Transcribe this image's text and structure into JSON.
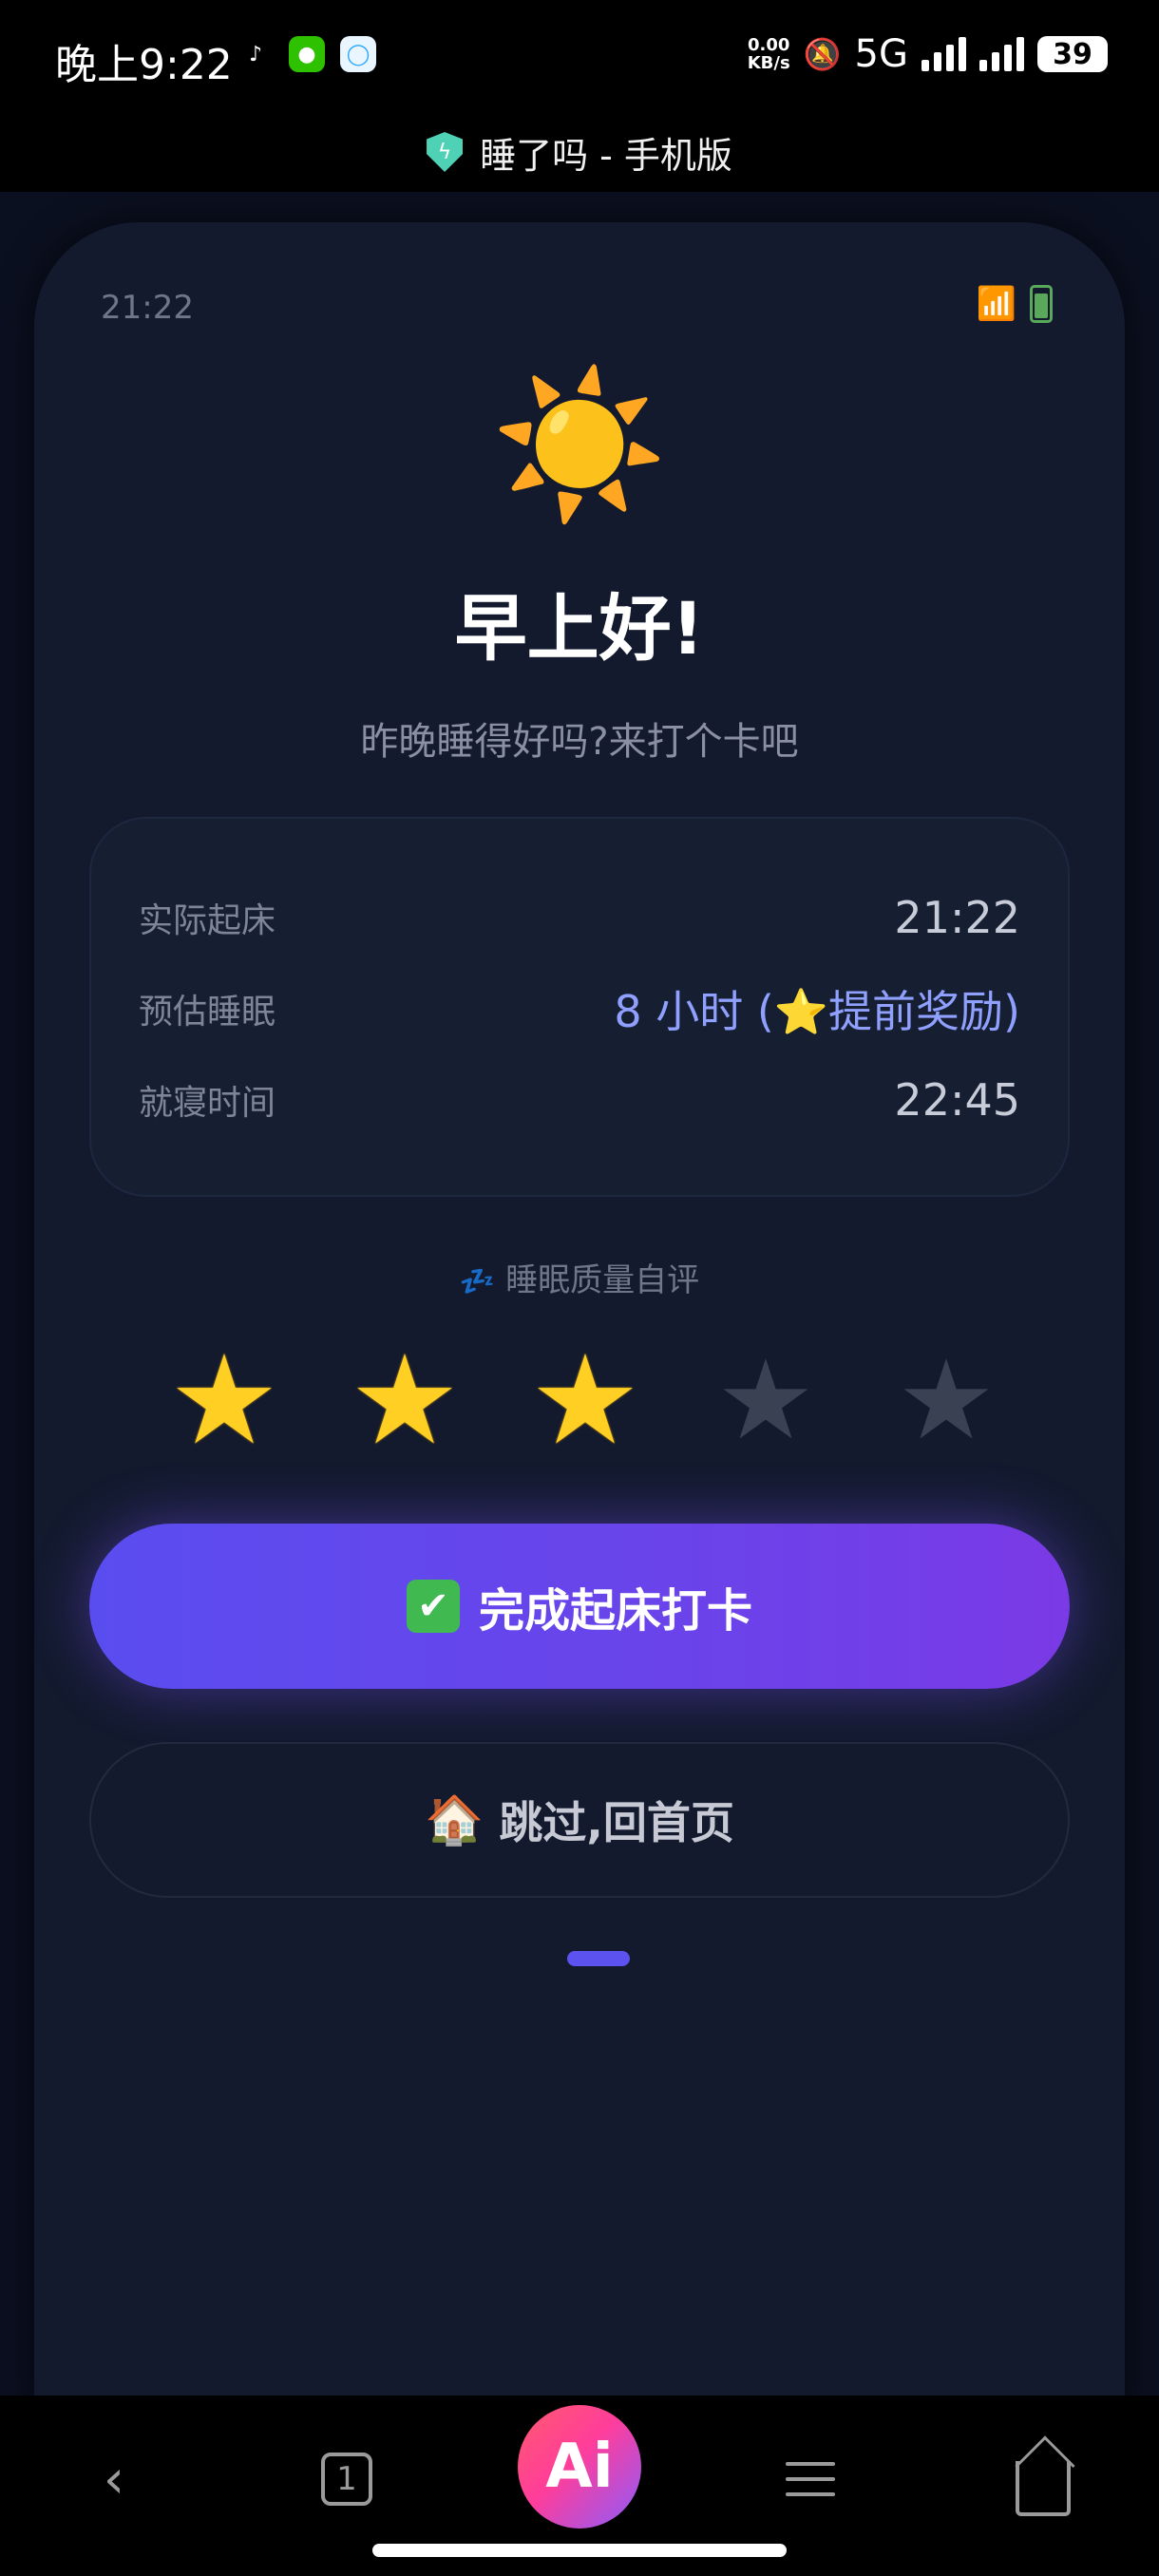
{
  "status_bar": {
    "time": "晚上9:22",
    "net_speed_top": "0.00",
    "net_speed_bottom": "KB/s",
    "network": "5G",
    "battery": "39",
    "app_icons": [
      "tiktok-icon",
      "wechat-icon",
      "cloud-icon"
    ]
  },
  "browser": {
    "title": "睡了吗 - 手机版"
  },
  "mock_status": {
    "time": "21:22"
  },
  "hero": {
    "icon": "☀️",
    "greeting": "早上好!",
    "subtitle": "昨晚睡得好吗?来打个卡吧"
  },
  "info": {
    "rows": [
      {
        "label": "实际起床",
        "value": "21:22"
      },
      {
        "label": "预估睡眠",
        "value": "8 小时 (⭐提前奖励)"
      },
      {
        "label": "就寝时间",
        "value": "22:45"
      }
    ]
  },
  "rating": {
    "label": "睡眠质量自评",
    "zz_icon": "💤",
    "max": 5,
    "value": 3
  },
  "actions": {
    "primary_icon": "✔",
    "primary_label": "完成起床打卡",
    "secondary_icon": "🏠",
    "secondary_label": "跳过,回首页"
  },
  "bottom_nav": {
    "back": "‹",
    "tabs_count": "1",
    "ai_label": "Ai"
  },
  "colors": {
    "accent": "#6a43ea",
    "star_on": "#ffcf24",
    "star_off": "#3a4152",
    "card_bg": "#131a2e"
  }
}
